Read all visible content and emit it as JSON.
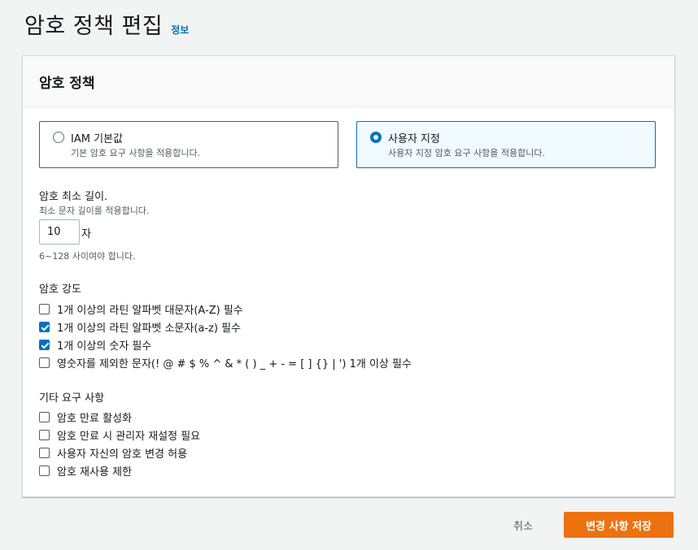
{
  "page": {
    "title": "암호 정책 편집",
    "info_link": "정보"
  },
  "panel": {
    "title": "암호 정책",
    "options": [
      {
        "label": "IAM 기본값",
        "description": "기본 암호 요구 사항을 적용합니다.",
        "selected": false
      },
      {
        "label": "사용자 지정",
        "description": "사용자 지정 암호 요구 사항을 적용합니다.",
        "selected": true
      }
    ],
    "min_length": {
      "label": "암호 최소 길이.",
      "description": "최소 문자 길이를 적용합니다.",
      "value": "10",
      "unit": "자",
      "constraint": "6~128 사이여야 합니다."
    },
    "strength": {
      "label": "암호 강도",
      "items": [
        {
          "label": "1개 이상의 라틴 알파벳 대문자(A-Z) 필수",
          "checked": false
        },
        {
          "label": "1개 이상의 라틴 알파벳 소문자(a-z) 필수",
          "checked": true
        },
        {
          "label": "1개 이상의 숫자 필수",
          "checked": true
        },
        {
          "label": "영숫자를 제외한 문자(! @ # $ % ^ & * ( ) _ + - = [ ] {} | ') 1개 이상 필수",
          "checked": false
        }
      ]
    },
    "other": {
      "label": "기타 요구 사항",
      "items": [
        {
          "label": "암호 만료 활성화",
          "checked": false
        },
        {
          "label": "암호 만료 시 관리자 재설정 필요",
          "checked": false
        },
        {
          "label": "사용자 자신의 암호 변경 허용",
          "checked": false
        },
        {
          "label": "암호 재사용 제한",
          "checked": false
        }
      ]
    }
  },
  "actions": {
    "cancel": "취소",
    "save": "변경 사항 저장"
  },
  "colors": {
    "accent": "#0073bb",
    "primary_button": "#ec7211"
  }
}
